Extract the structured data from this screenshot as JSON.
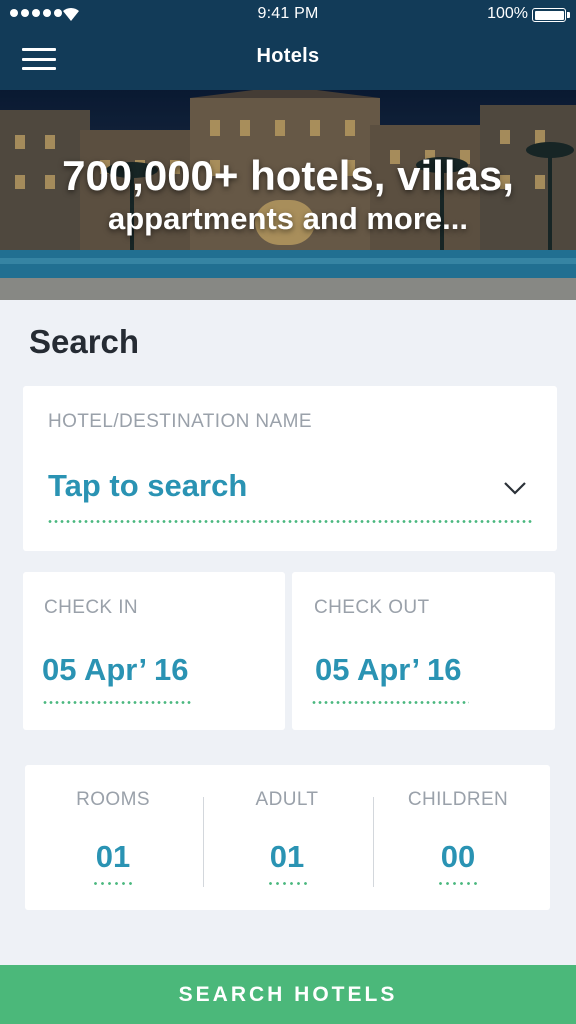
{
  "status_bar": {
    "time": "9:41 PM",
    "battery": "100%"
  },
  "nav": {
    "title": "Hotels",
    "menu_icon": "hamburger-menu-icon"
  },
  "hero": {
    "line1": "700,000+ hotels, villas,",
    "line2": "appartments and more..."
  },
  "search": {
    "title": "Search",
    "destination": {
      "label": "HOTEL/DESTINATION NAME",
      "value": "Tap to search",
      "icon": "chevron-down-icon"
    },
    "check_in": {
      "label": "CHECK IN",
      "value": "05 Apr’ 16"
    },
    "check_out": {
      "label": "CHECK OUT",
      "value": "05 Apr’ 16"
    },
    "rooms": {
      "label": "ROOMS",
      "value": "01"
    },
    "adult": {
      "label": "ADULT",
      "value": "01"
    },
    "children": {
      "label": "CHILDREN",
      "value": "00"
    },
    "submit_label": "SEARCH HOTELS"
  },
  "colors": {
    "navbar": "#123b58",
    "accent_blue": "#2a93b3",
    "accent_green": "#4bb87a",
    "background": "#eef1f6"
  }
}
